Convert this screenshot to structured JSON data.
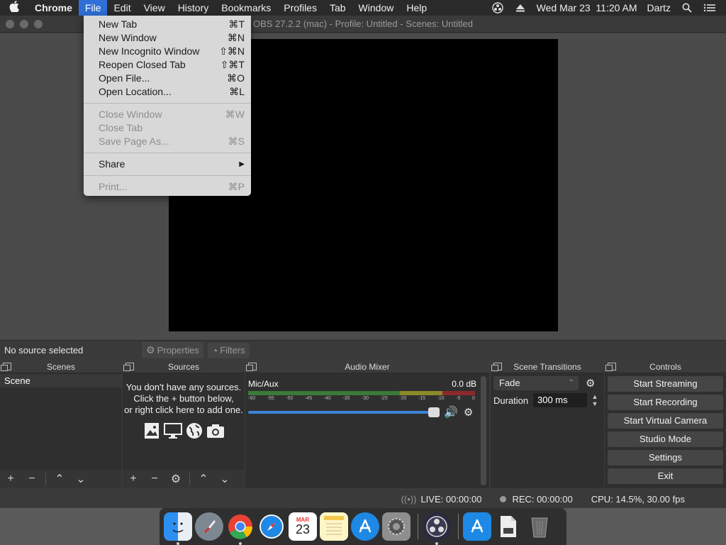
{
  "menubar": {
    "app": "Chrome",
    "items": [
      "File",
      "Edit",
      "View",
      "History",
      "Bookmarks",
      "Profiles",
      "Tab",
      "Window",
      "Help"
    ],
    "datetime": "Wed Mar 23  11:20 AM",
    "user": "Dartz"
  },
  "window": {
    "title": "OBS 27.2.2 (mac) - Profile: Untitled - Scenes: Untitled"
  },
  "file_menu": {
    "groups": [
      [
        {
          "label": "New Tab",
          "shortcut": "⌘T",
          "enabled": true
        },
        {
          "label": "New Window",
          "shortcut": "⌘N",
          "enabled": true
        },
        {
          "label": "New Incognito Window",
          "shortcut": "⇧⌘N",
          "enabled": true
        },
        {
          "label": "Reopen Closed Tab",
          "shortcut": "⇧⌘T",
          "enabled": true
        },
        {
          "label": "Open File...",
          "shortcut": "⌘O",
          "enabled": true
        },
        {
          "label": "Open Location...",
          "shortcut": "⌘L",
          "enabled": true
        }
      ],
      [
        {
          "label": "Close Window",
          "shortcut": "⌘W",
          "enabled": false
        },
        {
          "label": "Close Tab",
          "shortcut": "",
          "enabled": false
        },
        {
          "label": "Save Page As...",
          "shortcut": "⌘S",
          "enabled": false
        }
      ],
      [
        {
          "label": "Share",
          "shortcut": "▶",
          "enabled": true
        }
      ],
      [
        {
          "label": "Print...",
          "shortcut": "⌘P",
          "enabled": false
        }
      ]
    ]
  },
  "source_toolbar": {
    "no_source": "No source selected",
    "properties": "Properties",
    "filters": "Filters"
  },
  "docks": {
    "scenes": {
      "title": "Scenes",
      "items": [
        "Scene"
      ]
    },
    "sources": {
      "title": "Sources",
      "empty_line1": "You don't have any sources.",
      "empty_line2": "Click the + button below,",
      "empty_line3": "or right click here to add one."
    },
    "mixer": {
      "title": "Audio Mixer",
      "track_name": "Mic/Aux",
      "track_db": "0.0 dB",
      "ticks": [
        "-60",
        "-55",
        "-50",
        "-45",
        "-40",
        "-35",
        "-30",
        "-25",
        "-20",
        "-15",
        "-10",
        "-5",
        "0"
      ]
    },
    "transitions": {
      "title": "Scene Transitions",
      "selected": "Fade",
      "duration_label": "Duration",
      "duration_value": "300 ms"
    },
    "controls": {
      "title": "Controls",
      "buttons": [
        "Start Streaming",
        "Start Recording",
        "Start Virtual Camera",
        "Studio Mode",
        "Settings",
        "Exit"
      ]
    }
  },
  "status": {
    "live": "LIVE: 00:00:00",
    "rec": "REC: 00:00:00",
    "cpu": "CPU: 14.5%, 30.00 fps"
  },
  "dock_icons": [
    "finder-icon",
    "launchpad-icon",
    "chrome-icon",
    "safari-icon",
    "calendar-icon",
    "notes-icon",
    "app-store-icon",
    "system-preferences-icon",
    "obs-icon",
    "app-store-icon-2",
    "document-icon",
    "trash-icon"
  ],
  "calendar": {
    "month": "MAR",
    "day": "23"
  }
}
